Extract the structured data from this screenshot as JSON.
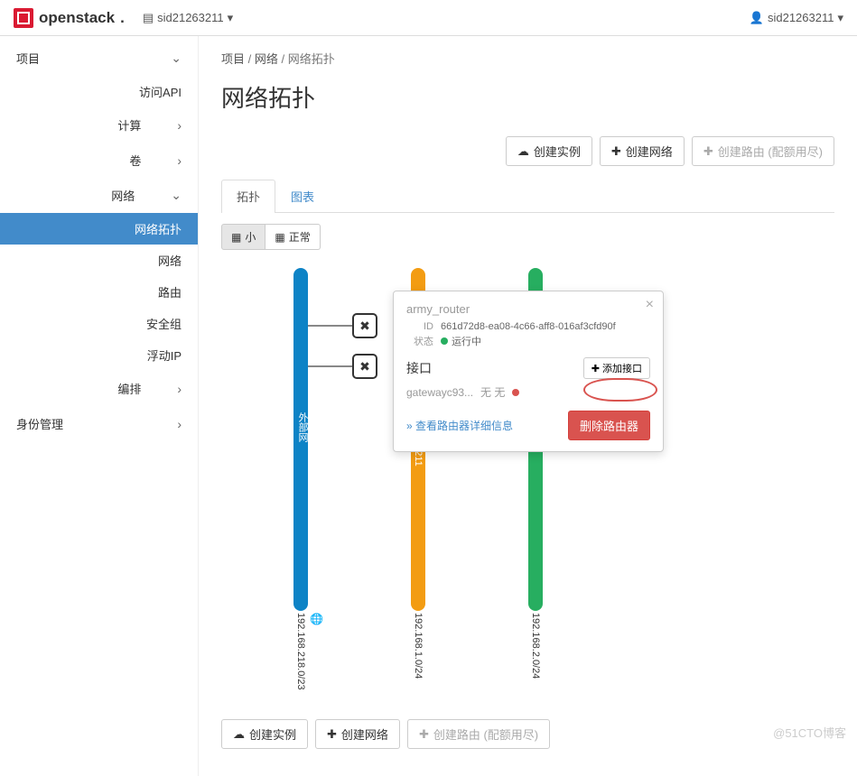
{
  "topbar": {
    "brand": "openstack",
    "project_selector": "sid21263211",
    "user": "sid21263211"
  },
  "sidebar": {
    "project_label": "项目",
    "access_api": "访问API",
    "compute": "计算",
    "volume": "卷",
    "network": "网络",
    "network_children": {
      "topology": "网络拓扑",
      "networks": "网络",
      "routers": "路由",
      "security_groups": "安全组",
      "floating_ips": "浮动IP"
    },
    "orchestration": "编排",
    "identity": "身份管理"
  },
  "breadcrumb": {
    "p1": "项目",
    "p2": "网络",
    "p3": "网络拓扑"
  },
  "page_title": "网络拓扑",
  "actions": {
    "launch_instance": "创建实例",
    "create_network": "创建网络",
    "create_router_disabled": "创建路由 (配额用尽)"
  },
  "tabs": {
    "topology": "拓扑",
    "graph": "图表"
  },
  "toggle": {
    "small": "小",
    "normal": "正常"
  },
  "topology": {
    "net2_label": "63211",
    "ip1": "192.168.218.0/23",
    "ip2": "192.168.1.0/24",
    "ip3": "192.168.2.0/24"
  },
  "popup": {
    "title": "army_router",
    "id_label": "ID",
    "id_value": "661d72d8-ea08-4c66-aff8-016af3cfd90f",
    "status_label": "状态",
    "status_value": "运行中",
    "interfaces_heading": "接口",
    "add_interface": "添加接口",
    "gateway_name": "gatewayc93...",
    "gateway_none": "无 无",
    "detail_link": "» 查看路由器详细信息",
    "delete_router": "删除路由器"
  },
  "watermark": "@51CTO博客"
}
